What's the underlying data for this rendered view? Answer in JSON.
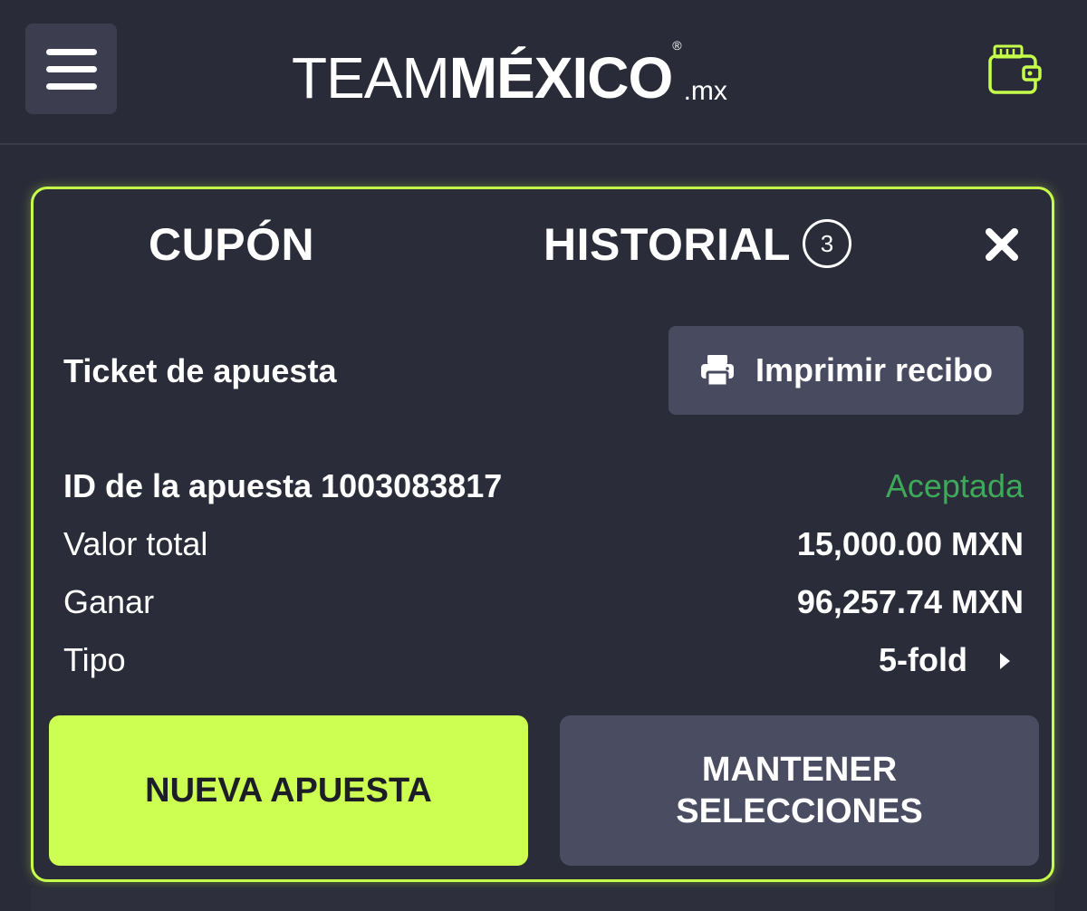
{
  "header": {
    "logo": {
      "team": "TEAM",
      "mexico": "MÉXICO",
      "registered": "®",
      "suffix": ".mx"
    },
    "menu_icon": "hamburger-menu-icon",
    "wallet_icon": "wallet-icon"
  },
  "coupon": {
    "tabs": {
      "cupon": "CUPÓN",
      "historial": "HISTORIAL",
      "historial_count": "3"
    },
    "close_icon": "close-icon",
    "ticket_title": "Ticket de apuesta",
    "print_button": {
      "label": "Imprimir recibo",
      "icon": "printer-icon"
    },
    "details": {
      "id_label": "ID de la apuesta 1003083817",
      "status": "Aceptada",
      "valor_label": "Valor total",
      "valor_value": "15,000.00 MXN",
      "ganar_label": "Ganar",
      "ganar_value": "96,257.74 MXN",
      "tipo_label": "Tipo",
      "tipo_value": "5-fold"
    },
    "buttons": {
      "nueva": "NUEVA APUESTA",
      "mantener_line1": "MANTENER",
      "mantener_line2": "SELECCIONES"
    }
  },
  "colors": {
    "background": "#2a2b38",
    "accent": "#c6ff4a",
    "status_accepted": "#3fa95a",
    "secondary_button": "#4a4c61"
  }
}
